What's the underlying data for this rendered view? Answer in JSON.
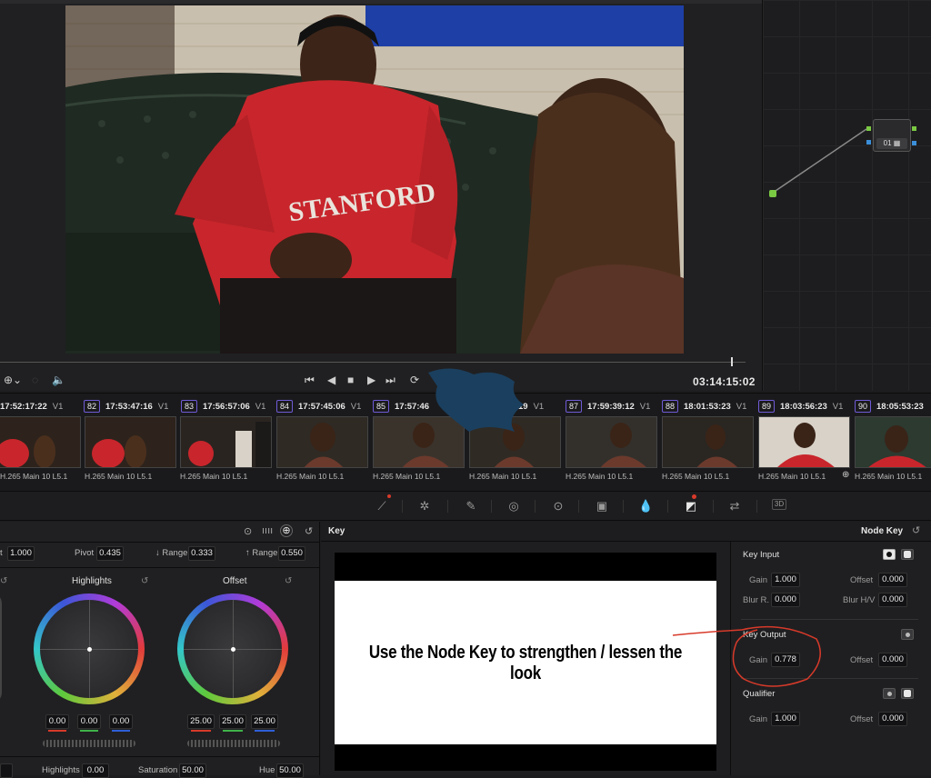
{
  "viewer": {
    "timecode": "03:14:15:02"
  },
  "node": {
    "label": "01"
  },
  "clips": [
    {
      "num": "",
      "tc": "17:52:17:22",
      "track": "V1",
      "codec": "H.265 Main 10 L5.1"
    },
    {
      "num": "82",
      "tc": "17:53:47:16",
      "track": "V1",
      "codec": "H.265 Main 10 L5.1"
    },
    {
      "num": "83",
      "tc": "17:56:57:06",
      "track": "V1",
      "codec": "H.265 Main 10 L5.1"
    },
    {
      "num": "84",
      "tc": "17:57:45:06",
      "track": "V1",
      "codec": "H.265 Main 10 L5.1"
    },
    {
      "num": "85",
      "tc": "17:57:46",
      "track": "",
      "codec": "H.265 Main 10 L5.1"
    },
    {
      "num": "",
      "tc": "19",
      "track": "V1",
      "codec": "H.265 Main 10 L5.1"
    },
    {
      "num": "87",
      "tc": "17:59:39:12",
      "track": "V1",
      "codec": "H.265 Main 10 L5.1"
    },
    {
      "num": "88",
      "tc": "18:01:53:23",
      "track": "V1",
      "codec": "H.265 Main 10 L5.1"
    },
    {
      "num": "89",
      "tc": "18:03:56:23",
      "track": "V1",
      "codec": "H.265 Main 10 L5.1"
    },
    {
      "num": "90",
      "tc": "18:05:53:23",
      "track": "",
      "codec": "H.265 Main 10 L5.1"
    }
  ],
  "primaries": {
    "contrast_value": "1.000",
    "pivot_label": "Pivot",
    "pivot_value": "0.435",
    "range_low_label": "↓ Range",
    "range_low_value": "0.333",
    "range_high_label": "↑ Range",
    "range_high_value": "0.550",
    "highlights_title": "Highlights",
    "offset_title": "Offset",
    "highlights_values": [
      "0.00",
      "0.00",
      "0.00"
    ],
    "offset_values": [
      "25.00",
      "25.00",
      "25.00"
    ],
    "bottom_highlights_label": "Highlights",
    "bottom_highlights_value": "0.00",
    "saturation_label": "Saturation",
    "saturation_value": "50.00",
    "hue_label": "Hue",
    "hue_value": "50.00"
  },
  "key": {
    "panel_title": "Key",
    "mode_label": "Node Key",
    "annotation_text": "Use the Node Key  to strengthen / lessen the look",
    "key_input": {
      "title": "Key Input",
      "gain_label": "Gain",
      "gain": "1.000",
      "offset_label": "Offset",
      "offset": "0.000",
      "blur_r_label": "Blur R.",
      "blur_r": "0.000",
      "blur_hv_label": "Blur H/V",
      "blur_hv": "0.000"
    },
    "key_output": {
      "title": "Key Output",
      "gain_label": "Gain",
      "gain": "0.778",
      "offset_label": "Offset",
      "offset": "0.000"
    },
    "qualifier": {
      "title": "Qualifier",
      "gain_label": "Gain",
      "gain": "1.000",
      "offset_label": "Offset",
      "offset": "0.000"
    }
  },
  "colors": {
    "accent_red": "#d83a2a",
    "clip_num_border": "#6f5bd6",
    "annotation_blue": "#1b3f5e"
  }
}
